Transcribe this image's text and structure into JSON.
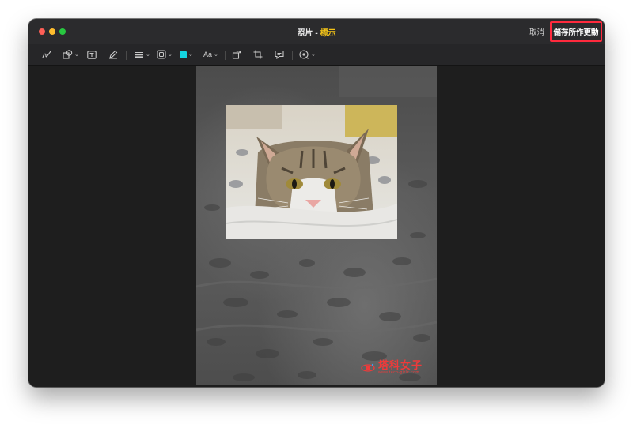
{
  "window": {
    "title_app": "照片",
    "title_separator": "-",
    "title_mode": "標示",
    "cancel_label": "取消",
    "save_label": "儲存所作更動"
  },
  "toolbar": {
    "tools": [
      {
        "icon": "sketch-icon"
      },
      {
        "icon": "shapes-icon",
        "dropdown": true
      },
      {
        "icon": "text-box-icon"
      },
      {
        "icon": "highlighter-icon"
      },
      {
        "icon": "line-style-icon",
        "dropdown": true
      },
      {
        "icon": "border-style-icon",
        "dropdown": true
      },
      {
        "icon": "color-swatch",
        "dropdown": true,
        "color": "#14d4e0"
      },
      {
        "icon": "font-style",
        "label": "Aa",
        "dropdown": true
      },
      {
        "icon": "rotate-icon"
      },
      {
        "icon": "crop-icon"
      },
      {
        "icon": "description-icon"
      },
      {
        "icon": "markup-options-icon",
        "dropdown": true
      }
    ],
    "text_style_label": "Aa"
  },
  "watermark": {
    "title": "塔科女子",
    "subtitle": "www.tech-girlz.com"
  },
  "colors": {
    "accent_save_border": "#ff2a3d",
    "title_mode": "#f5c518",
    "watermark": "#ef3a3a"
  }
}
